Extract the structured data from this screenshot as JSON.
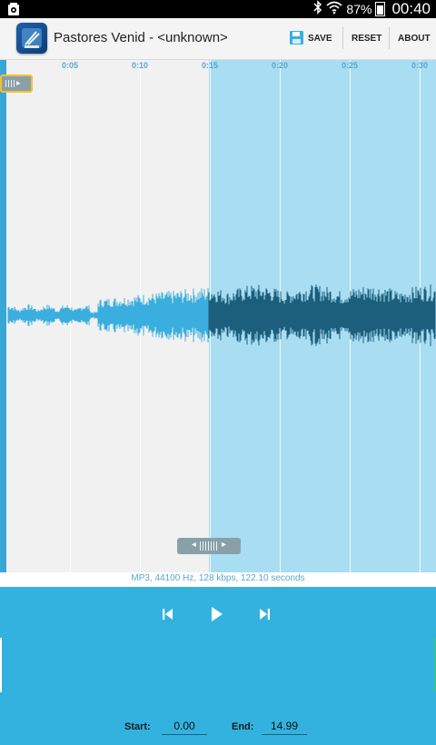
{
  "status_bar": {
    "battery": "87%",
    "time": "00:40",
    "icons": [
      "settings-notification-icon",
      "bluetooth-icon",
      "wifi-icon",
      "battery-icon"
    ]
  },
  "action_bar": {
    "title": "Pastores Venid - <unknown>",
    "save_label": "SAVE",
    "reset_label": "RESET",
    "about_label": "ABOUT"
  },
  "waveform": {
    "timeline_ticks": [
      "0:05",
      "0:10",
      "0:15",
      "0:20",
      "0:25",
      "0:30"
    ],
    "file_info": "MP3, 44100 Hz, 128 kbps, 122.10 seconds"
  },
  "controls": {
    "start_label": "Start:",
    "start_value": "0.00",
    "end_label": "End:",
    "end_value": "14.99"
  },
  "colors": {
    "accent": "#33b2e0",
    "waveform_unselected": "#3aaede",
    "waveform_selected": "#1c5f7d",
    "selection_bg": "#a8ddf2",
    "marker_border": "#f2c233"
  }
}
